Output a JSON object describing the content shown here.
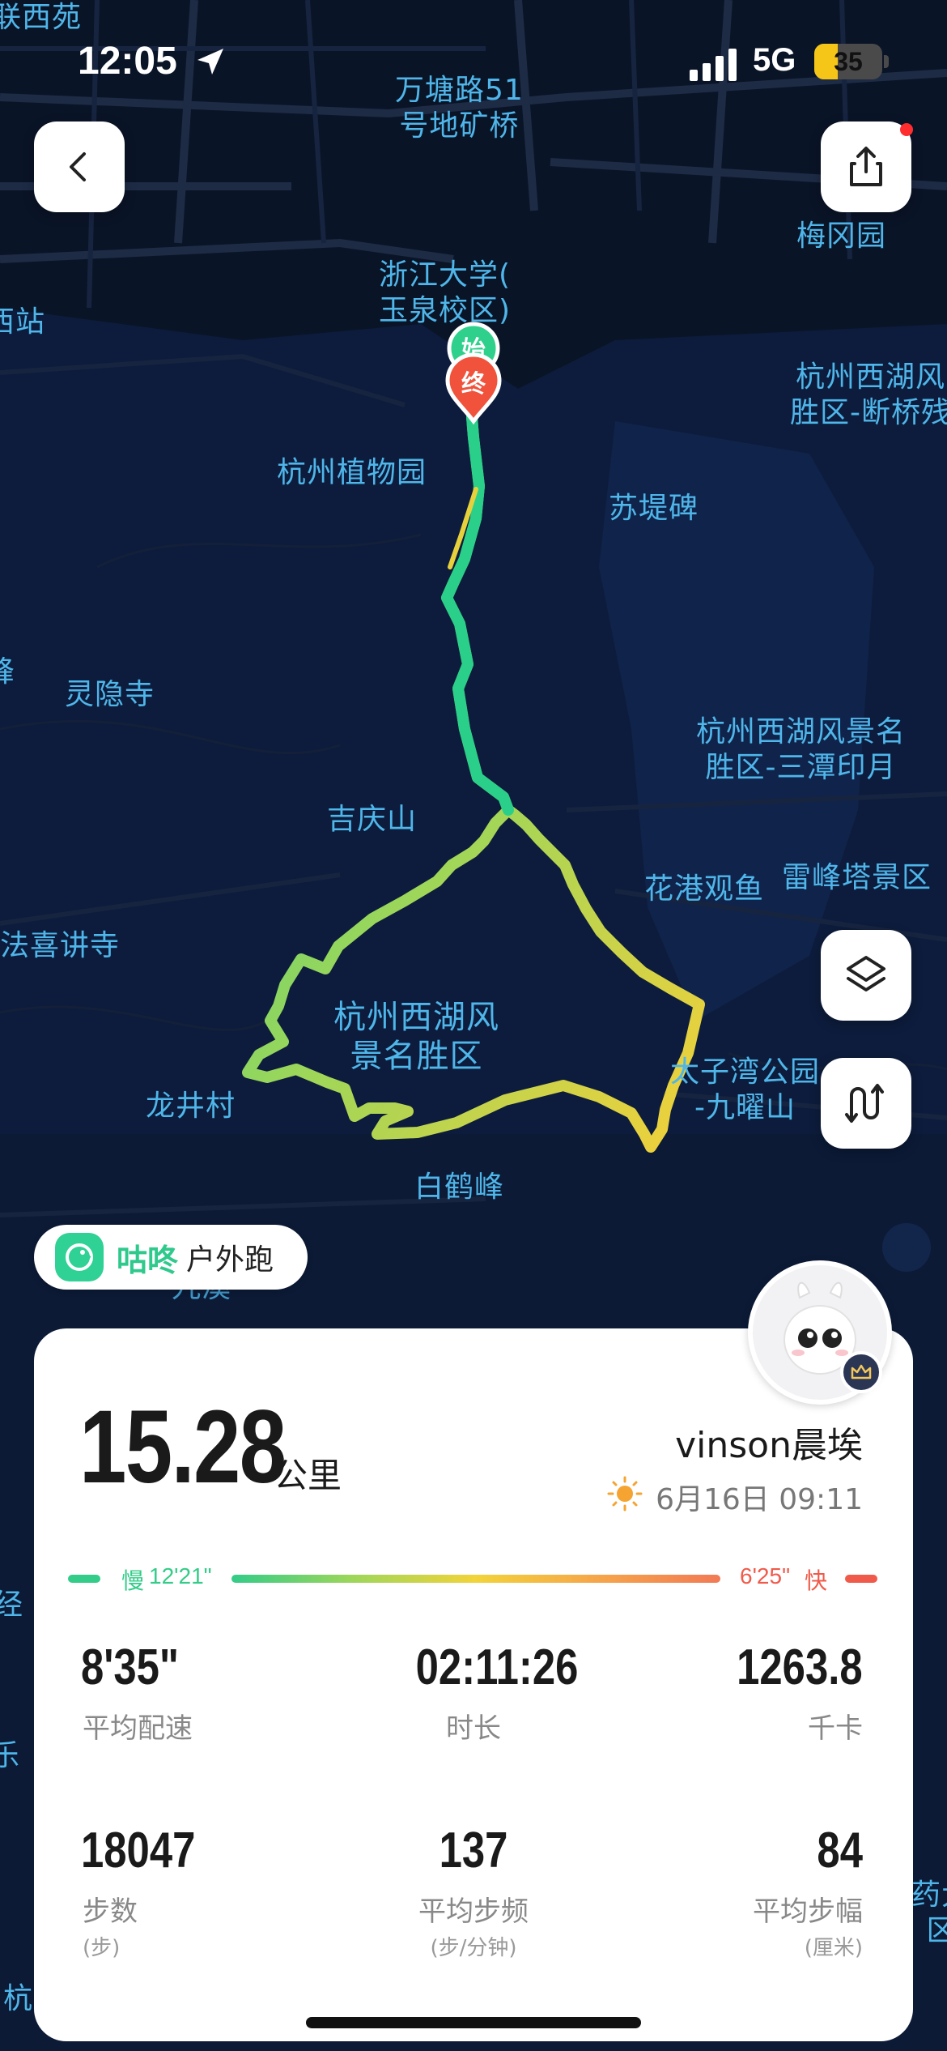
{
  "status_bar": {
    "time": "12:05",
    "network": "5G",
    "battery": "35",
    "battery_level": 0.35
  },
  "map": {
    "labels": [
      "联西苑",
      "万塘路51\n号地矿桥",
      "梅冈园",
      "浙江大学(\n玉泉校区)",
      "西站",
      "杭州西湖风\n胜区-断桥残",
      "杭州植物园",
      "苏堤碑",
      "峰",
      "灵隐寺",
      "杭州西湖风景名\n胜区-三潭印月",
      "吉庆山",
      "花港观鱼",
      "雷峰塔景区",
      "法喜讲寺",
      "杭州西湖风\n景名胜区",
      "太子湾公园\n-九曜山",
      "龙井村",
      "白鹤峰",
      "九溪",
      "经",
      "乐",
      "杭",
      "药大\n区"
    ],
    "start_marker": "始",
    "end_marker": "终"
  },
  "app_badge": {
    "app_name": "咕咚",
    "mode": "户外跑"
  },
  "summary": {
    "distance": "15.28",
    "distance_unit": "公里",
    "user_name": "vinson晨埃",
    "date_time": "6月16日 09:11",
    "pace_slow_label": "慢",
    "pace_slow_value": "12'21\"",
    "pace_fast_value": "6'25\"",
    "pace_fast_label": "快",
    "pace_slow_color": "#33cc88",
    "pace_fast_color": "#f05a4a"
  },
  "stats": [
    {
      "value": "8'35\"",
      "label": "平均配速",
      "sub": ""
    },
    {
      "value": "02:11:26",
      "label": "时长",
      "sub": ""
    },
    {
      "value": "1263.8",
      "label": "千卡",
      "sub": ""
    },
    {
      "value": "18047",
      "label": "步数",
      "sub": "(步)"
    },
    {
      "value": "137",
      "label": "平均步频",
      "sub": "(步/分钟)"
    },
    {
      "value": "84",
      "label": "平均步幅",
      "sub": "(厘米)"
    }
  ],
  "icons": {
    "back": "chevron-left-icon",
    "share": "share-icon",
    "layers": "layers-icon",
    "route_replay": "route-icon",
    "weather": "sun-icon",
    "crown": "crown-icon"
  }
}
